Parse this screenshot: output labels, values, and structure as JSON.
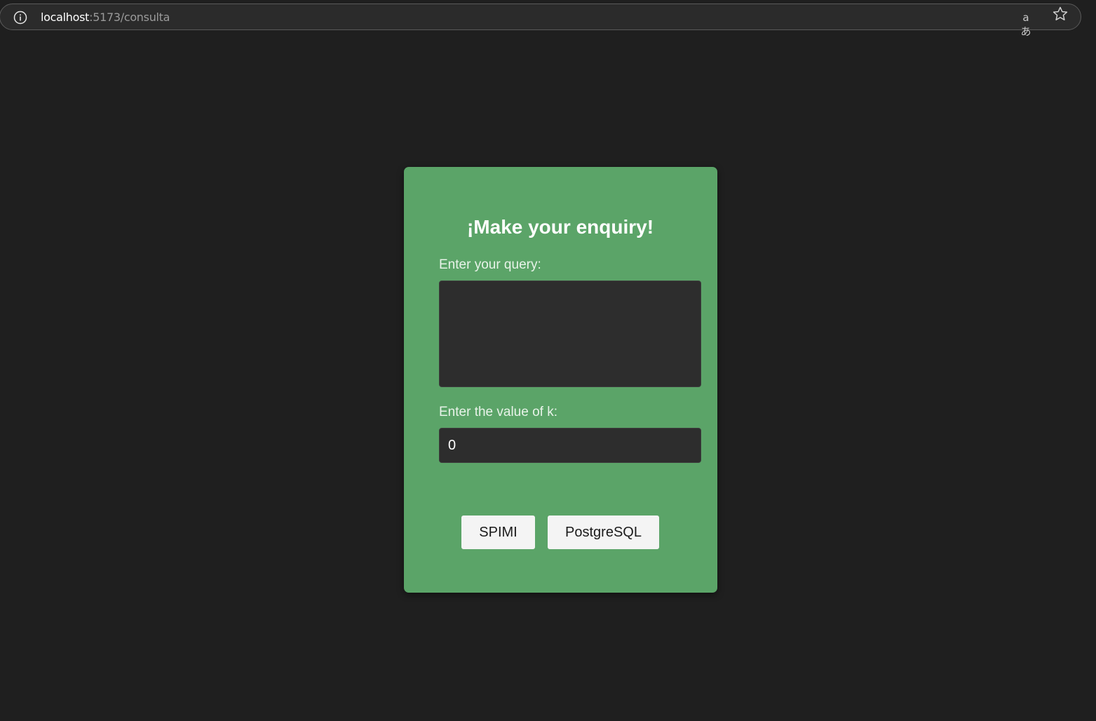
{
  "browser": {
    "url_host": "localhost",
    "url_path": ":5173/consulta",
    "info_icon": "info-icon",
    "translate_icon": "translate-icon",
    "translate_glyph": "aあ",
    "bookmark_icon": "star-icon"
  },
  "card": {
    "title": "¡Make your enquiry!",
    "query_label": "Enter your query:",
    "query_value": "",
    "k_label": "Enter the value of k:",
    "k_value": "0",
    "buttons": {
      "spimi": "SPIMI",
      "postgresql": "PostgreSQL"
    }
  },
  "colors": {
    "page_background": "#1f1f1f",
    "card_background": "#5ba468",
    "input_background": "#2d2d2d",
    "button_background": "#f4f4f4"
  }
}
